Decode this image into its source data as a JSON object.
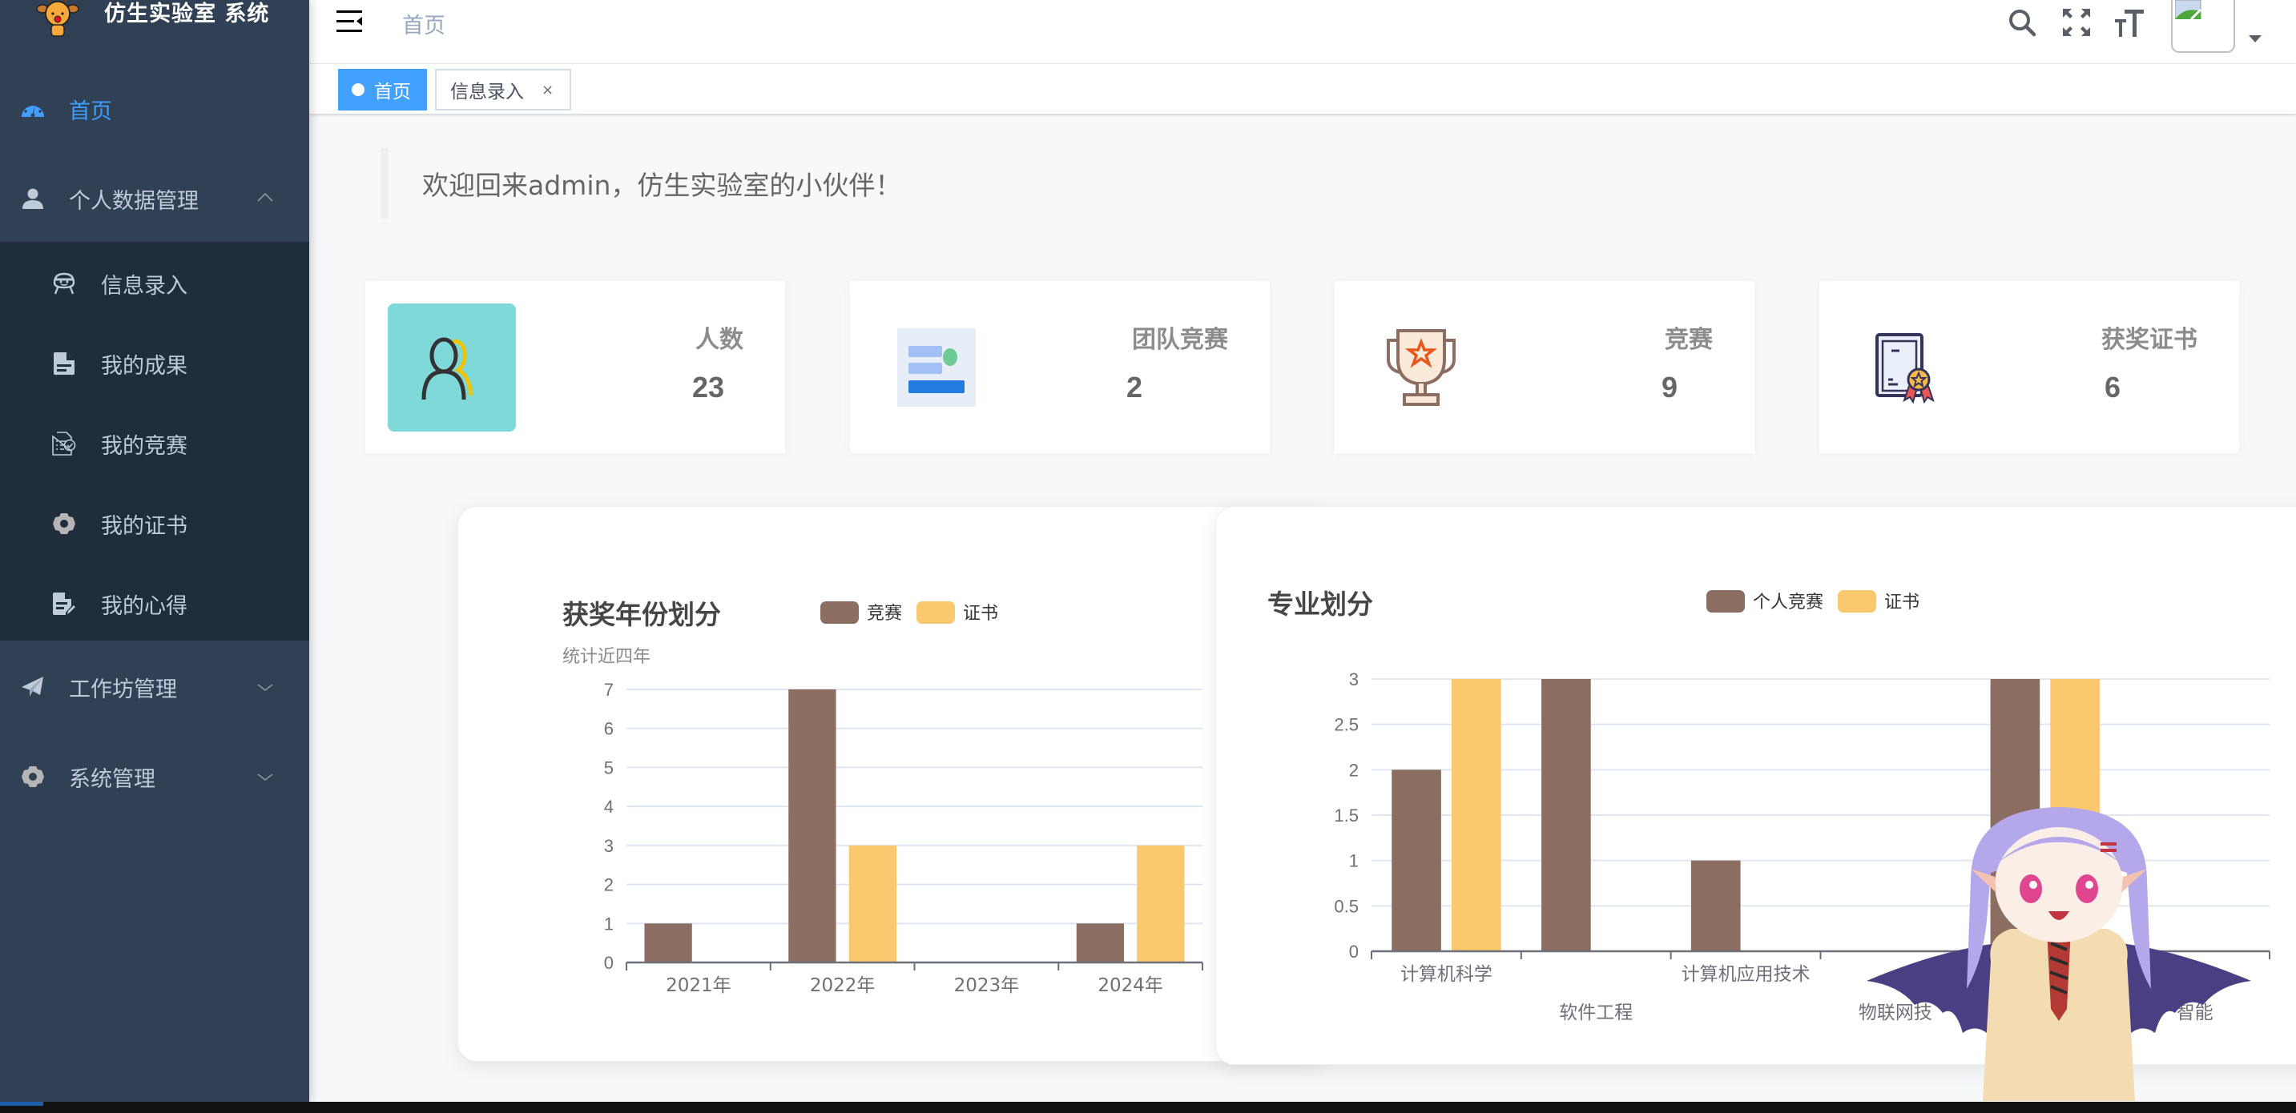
{
  "app": {
    "title": "仿生实验室 系统"
  },
  "sidebar": {
    "items": [
      {
        "label": "首页",
        "icon": "dashboard-icon",
        "active": true
      },
      {
        "label": "个人数据管理",
        "icon": "user-icon",
        "expanded": true
      },
      {
        "label": "工作坊管理",
        "icon": "paper-plane-icon",
        "expanded": false
      },
      {
        "label": "系统管理",
        "icon": "gear-icon",
        "expanded": false
      }
    ],
    "submenu": [
      {
        "label": "信息录入",
        "icon": "robot-icon"
      },
      {
        "label": "我的成果",
        "icon": "document-icon"
      },
      {
        "label": "我的竞赛",
        "icon": "checklist-icon"
      },
      {
        "label": "我的证书",
        "icon": "gear-icon"
      },
      {
        "label": "我的心得",
        "icon": "edit-document-icon"
      }
    ]
  },
  "header": {
    "breadcrumb": "首页",
    "icons": [
      "search-icon",
      "fullscreen-icon",
      "font-size-icon"
    ],
    "avatar": "broken-image-icon"
  },
  "tags": [
    {
      "label": "首页",
      "active": true
    },
    {
      "label": "信息录入",
      "active": false,
      "close": "×"
    }
  ],
  "welcome": {
    "text": "欢迎回来admin，仿生实验室的小伙伴！"
  },
  "stats": [
    {
      "title": "人数",
      "value": "23",
      "icon": "people-icon"
    },
    {
      "title": "团队竞赛",
      "value": "2",
      "icon": "team-board-icon"
    },
    {
      "title": "竞赛",
      "value": "9",
      "icon": "trophy-icon"
    },
    {
      "title": "获奖证书",
      "value": "6",
      "icon": "certificate-icon"
    }
  ],
  "colors": {
    "sidebar_bg": "#304156",
    "submenu_bg": "#1f2d3d",
    "accent": "#409eff",
    "series_brown": "#8b6e61",
    "series_yellow": "#fac86e"
  },
  "chart_data": [
    {
      "type": "bar",
      "title": "获奖年份划分",
      "subtitle": "统计近四年",
      "categories": [
        "2021年",
        "2022年",
        "2023年",
        "2024年"
      ],
      "series": [
        {
          "name": "竞赛",
          "color": "#8b6e61",
          "values": [
            1,
            7,
            0,
            1
          ]
        },
        {
          "name": "证书",
          "color": "#fac86e",
          "values": [
            0,
            3,
            0,
            3
          ]
        }
      ],
      "yticks": [
        0,
        1,
        2,
        3,
        4,
        5,
        6,
        7
      ],
      "ylim": [
        0,
        7
      ],
      "grid": true,
      "legend": "top-center"
    },
    {
      "type": "bar",
      "title": "专业划分",
      "subtitle": "",
      "categories": [
        "计算机科学",
        "软件工程",
        "计算机应用技术",
        "物联网技",
        "",
        "智能"
      ],
      "series": [
        {
          "name": "个人竞赛",
          "color": "#8b6e61",
          "values": [
            2,
            3,
            1,
            0,
            3,
            0
          ]
        },
        {
          "name": "证书",
          "color": "#fac86e",
          "values": [
            3,
            0,
            0,
            0,
            3,
            0
          ]
        }
      ],
      "yticks": [
        0,
        0.5,
        1,
        1.5,
        2,
        2.5,
        3
      ],
      "ylim": [
        0,
        3
      ],
      "grid": true,
      "legend": "top-center"
    }
  ]
}
